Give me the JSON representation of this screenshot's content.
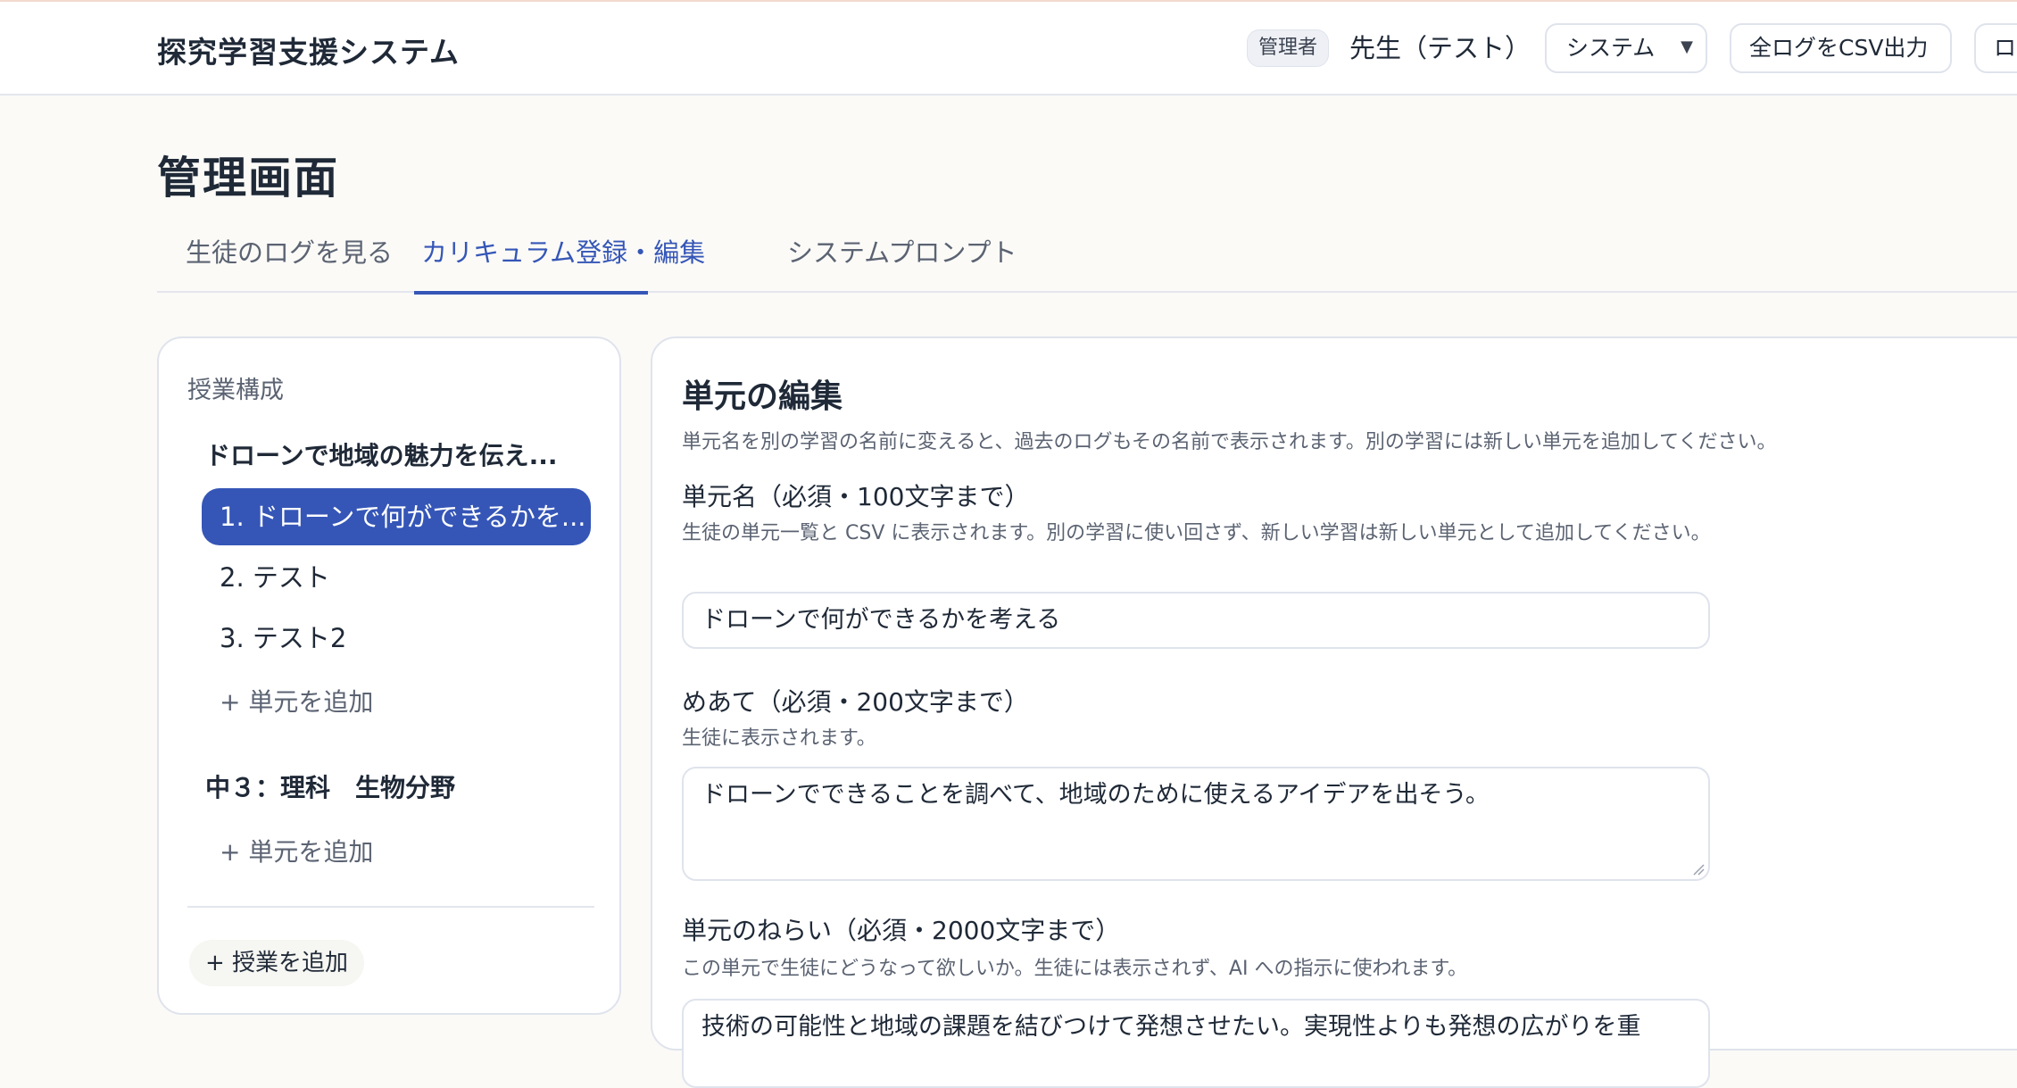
{
  "header": {
    "app_title": "探究学習支援システム",
    "role_badge": "管理者",
    "user_name": "先生（テスト）",
    "select_value": "システム",
    "csv_button": "全ログをCSV出力",
    "logout_button": "ロ"
  },
  "page": {
    "title": "管理画面",
    "tabs": [
      "生徒のログを見る",
      "カリキュラム登録・編集",
      "システムプロンプト"
    ]
  },
  "sidebar": {
    "heading": "授業構成",
    "lessons": [
      {
        "title": "ドローンで地域の魅力を伝え...",
        "units": [
          "1. ドローンで何ができるかを...",
          "2. テスト",
          "3. テスト2"
        ],
        "add_unit": "+ 単元を追加"
      },
      {
        "title": "中３：理科　生物分野",
        "units": [],
        "add_unit": "+ 単元を追加"
      }
    ],
    "add_lesson": "+ 授業を追加"
  },
  "editor": {
    "title": "単元の編集",
    "note": "単元名を別の学習の名前に変えると、過去のログもその名前で表示されます。別の学習には新しい単元を追加してください。",
    "name_label": "単元名（必須・100文字まで）",
    "name_help": "生徒の単元一覧と CSV に表示されます。別の学習に使い回さず、新しい学習は新しい単元として追加してください。",
    "name_value": "ドローンで何ができるかを考える",
    "goal_label": "めあて（必須・200文字まで）",
    "goal_help": "生徒に表示されます。",
    "goal_value": "ドローンでできることを調べて、地域のために使えるアイデアを出そう。",
    "aim_label": "単元のねらい（必須・2000文字まで）",
    "aim_help": "この単元で生徒にどうなって欲しいか。生徒には表示されず、AI への指示に使われます。",
    "aim_value": "技術の可能性と地域の課題を結びつけて発想させたい。実現性よりも発想の広がりを重"
  },
  "colors": {
    "accent": "#3556b7",
    "background": "#fbfaf7",
    "border": "#dfe3ec",
    "muted_text": "#5b6372"
  }
}
